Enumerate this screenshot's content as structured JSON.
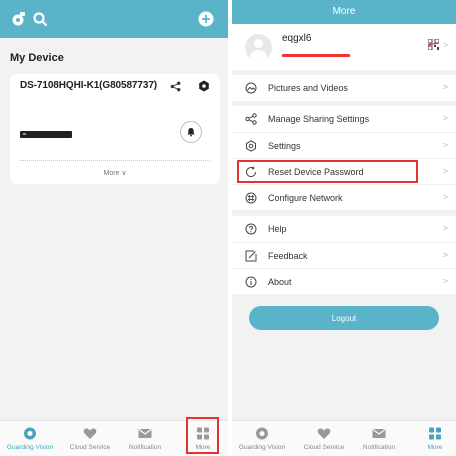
{
  "left": {
    "section_title": "My Device",
    "device": {
      "name": "DS-7108HQHI-K1(G80587737)",
      "more_label": "More ∨"
    },
    "bottom_nav": [
      {
        "label": "Guarding Vision",
        "icon": "guarding-vision-icon",
        "active": true
      },
      {
        "label": "Cloud Service",
        "icon": "heart-icon",
        "active": false
      },
      {
        "label": "Notification",
        "icon": "envelope-icon",
        "active": false
      },
      {
        "label": "More",
        "icon": "grid-icon",
        "active": false
      }
    ]
  },
  "right": {
    "title": "More",
    "username": "eqgxl6",
    "group1": [
      {
        "label": "Pictures and Videos",
        "icon": "gallery-icon"
      }
    ],
    "group2": [
      {
        "label": "Manage Sharing Settings",
        "icon": "share-icon"
      },
      {
        "label": "Settings",
        "icon": "settings-icon"
      },
      {
        "label": "Reset Device Password",
        "icon": "reset-icon"
      },
      {
        "label": "Configure Network",
        "icon": "network-icon"
      }
    ],
    "group3": [
      {
        "label": "Help",
        "icon": "help-icon"
      },
      {
        "label": "Feedback",
        "icon": "feedback-icon"
      },
      {
        "label": "About",
        "icon": "info-icon"
      }
    ],
    "logout_label": "Logout",
    "bottom_nav": [
      {
        "label": "Guarding Vision",
        "icon": "guarding-vision-icon",
        "active": false
      },
      {
        "label": "Cloud Service",
        "icon": "heart-icon",
        "active": false
      },
      {
        "label": "Notification",
        "icon": "envelope-icon",
        "active": false
      },
      {
        "label": "More",
        "icon": "grid-icon",
        "active": true
      }
    ]
  },
  "colors": {
    "accent": "#5ab4c9",
    "highlight_box": "#e03333"
  }
}
